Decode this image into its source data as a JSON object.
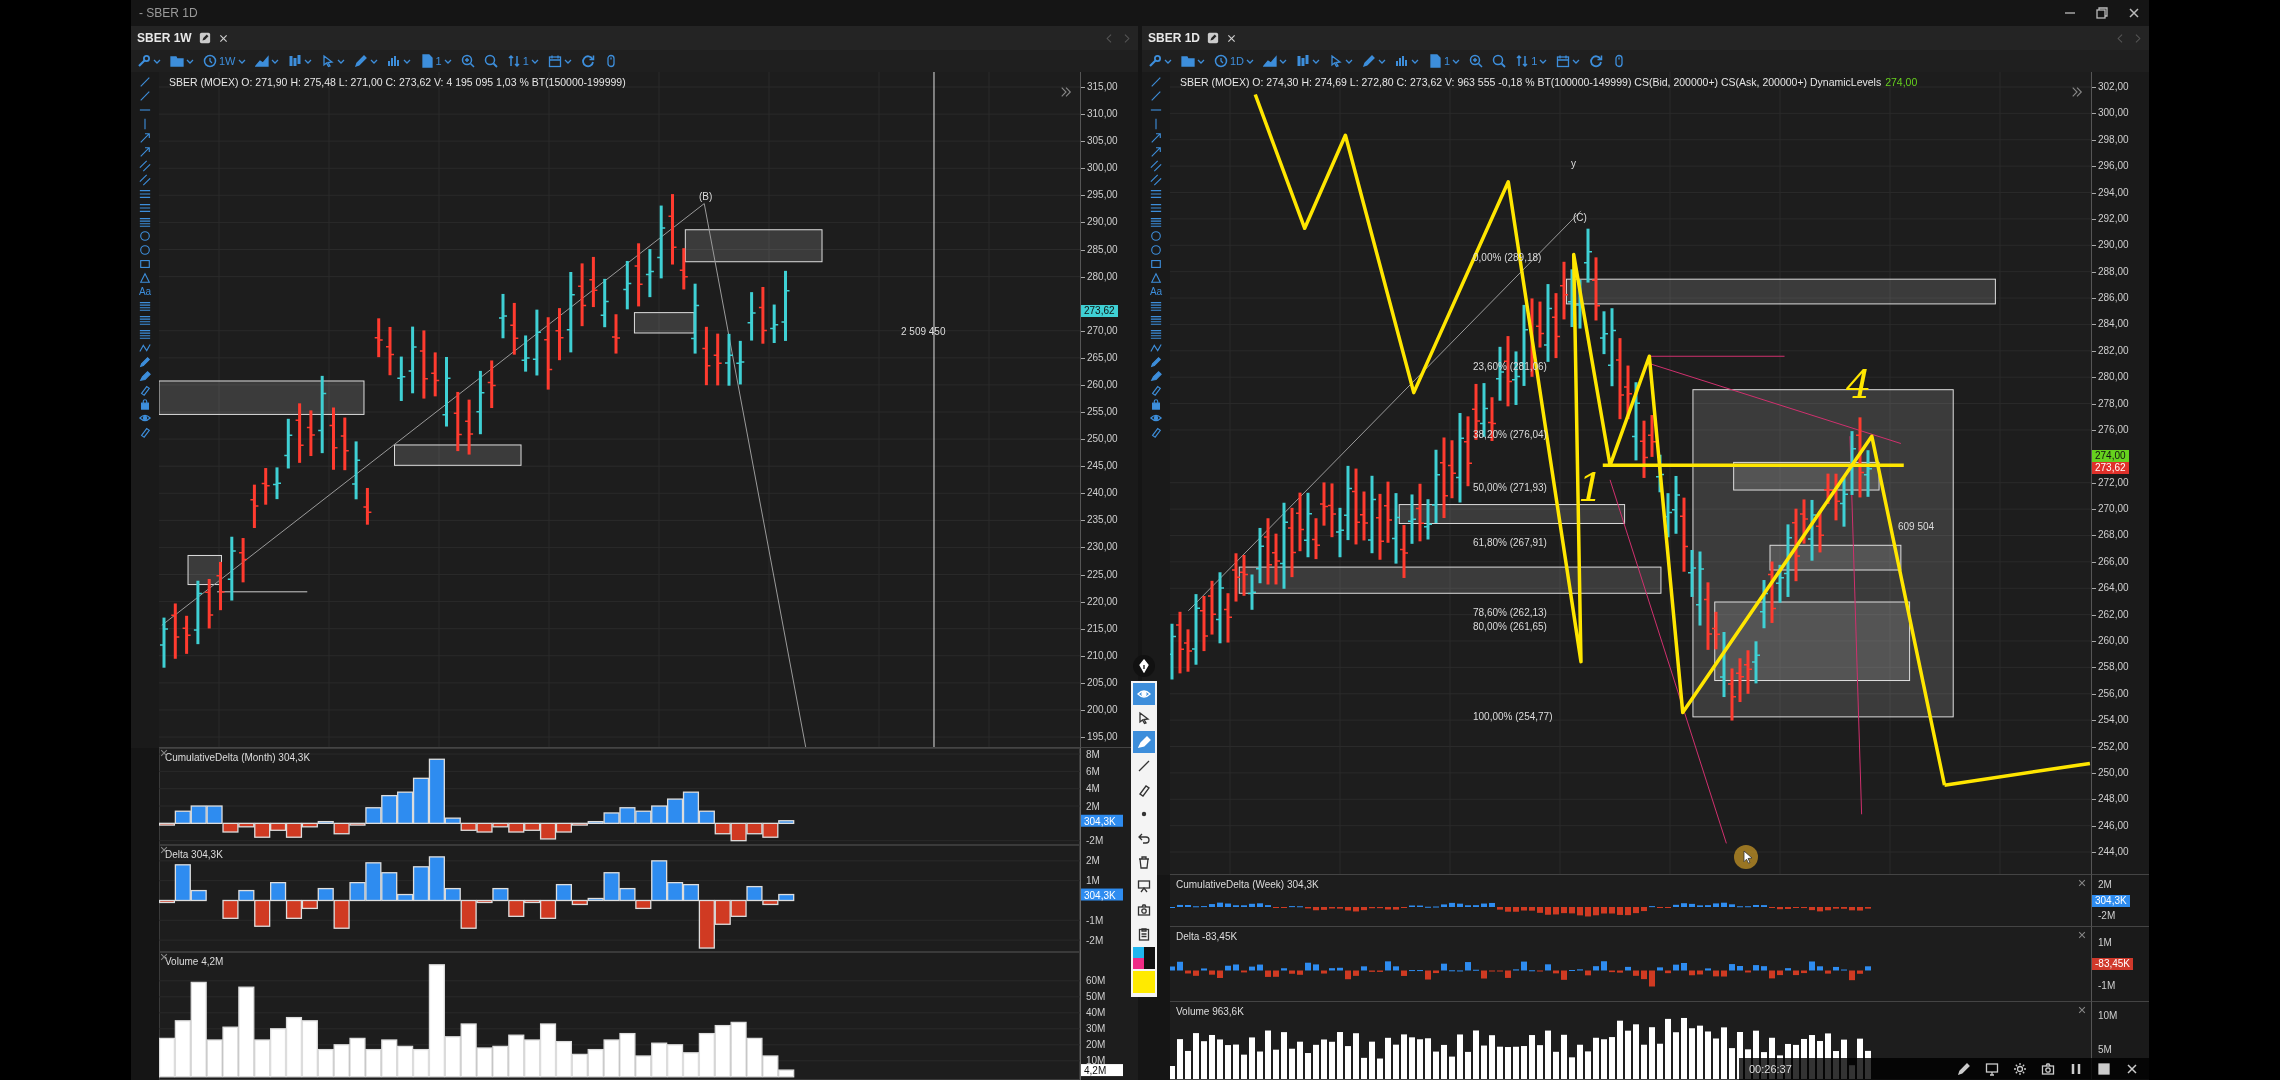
{
  "window": {
    "title": "- SBER 1D"
  },
  "panes": [
    {
      "tab": {
        "title": "SBER 1W"
      },
      "toolbar": {
        "timeframe": "1W",
        "template_count": "1",
        "sort_count": "1"
      },
      "tools": {
        "text_tool": "Aa"
      },
      "legend": "SBER (MOEX) O: 271,90  H: 275,48  L: 271,00  C: 273,62  V: 4 195 095  1,03 % BT(150000-199999)",
      "price_axis": {
        "ticks": [
          "315,00",
          "310,00",
          "305,00",
          "300,00",
          "295,00",
          "290,00",
          "285,00",
          "280,00",
          "270,00",
          "265,00",
          "260,00",
          "255,00",
          "250,00",
          "245,00",
          "240,00",
          "235,00",
          "230,00",
          "225,00",
          "220,00",
          "215,00",
          "210,00",
          "205,00",
          "200,00",
          "195,00"
        ],
        "markers": [
          {
            "text": "273,62",
            "color": "#3fd0d4"
          }
        ]
      },
      "chart_labels": [
        "(B)",
        "2 509 450"
      ],
      "indicators": [
        {
          "title": "CumulativeDelta (Month) 304,3K",
          "last": {
            "text": "304,3K",
            "color": "#2e8cf0"
          },
          "chart_data": {
            "type": "bar",
            "stacked": true,
            "grid": true,
            "categories": [
              null,
              null,
              null,
              null,
              null,
              null,
              null,
              null,
              null,
              null,
              null,
              null,
              null,
              null,
              null,
              null,
              null,
              null,
              null,
              null,
              null,
              null,
              null,
              null,
              null,
              null,
              null,
              null,
              null,
              null,
              null,
              null,
              null,
              null,
              null,
              null,
              null,
              null,
              null,
              null,
              null,
              null,
              null,
              null,
              null,
              null,
              null,
              null,
              null,
              null,
              null,
              null,
              null,
              null,
              null,
              null,
              null,
              null
            ],
            "ylim": [
              -2.5,
              8.7
            ],
            "yticks": [
              {
                "value": 8,
                "label": "8M"
              },
              {
                "value": 6,
                "label": "6M"
              },
              {
                "value": 4,
                "label": "4M"
              },
              {
                "value": 2,
                "label": "2M"
              },
              {
                "value": -2,
                "label": "-2M"
              }
            ],
            "series": [
              {
                "color": "#2e8cf0",
                "values": [
                  null,
                  1.4,
                  2.0,
                  2.0,
                  null,
                  null,
                  null,
                  null,
                  null,
                  null,
                  0.2,
                  null,
                  null,
                  1.8,
                  3.2,
                  3.6,
                  5.2,
                  7.4,
                  0.6,
                  null,
                  null,
                  null,
                  null,
                  null,
                  null,
                  null,
                  null,
                  0.2,
                  1.2,
                  1.8,
                  1.4,
                  2.0,
                  2.8,
                  3.6,
                  1.4,
                  null,
                  null,
                  null,
                  null,
                  0.3,
                  null,
                  null,
                  null,
                  null,
                  null,
                  null,
                  null,
                  null,
                  null,
                  null,
                  null,
                  null,
                  null,
                  null,
                  null,
                  null,
                  null,
                  null
                ]
              },
              {
                "color": "#d03a22",
                "values": [
                  -0.2,
                  null,
                  null,
                  null,
                  -1.0,
                  -0.4,
                  -1.6,
                  -0.8,
                  -1.6,
                  -0.4,
                  null,
                  -1.2,
                  -0.2,
                  null,
                  null,
                  null,
                  null,
                  null,
                  null,
                  -0.8,
                  -1.0,
                  -0.4,
                  -1.0,
                  -0.8,
                  -1.8,
                  -1.0,
                  -0.2,
                  null,
                  null,
                  null,
                  null,
                  null,
                  null,
                  null,
                  null,
                  -1.2,
                  -2.0,
                  -1.2,
                  -1.6,
                  null,
                  null,
                  null,
                  null,
                  null,
                  null,
                  null,
                  null,
                  null,
                  null,
                  null,
                  null,
                  null,
                  null,
                  null,
                  null,
                  null,
                  null,
                  null
                ]
              }
            ]
          }
        },
        {
          "title": "Delta 304,3K",
          "last": {
            "text": "304,3K",
            "color": "#2e8cf0"
          },
          "chart_data": {
            "type": "bar",
            "stacked": true,
            "grid": true,
            "categories": [
              null,
              null,
              null,
              null,
              null,
              null,
              null,
              null,
              null,
              null,
              null,
              null,
              null,
              null,
              null,
              null,
              null,
              null,
              null,
              null,
              null,
              null,
              null,
              null,
              null,
              null,
              null,
              null,
              null,
              null,
              null,
              null,
              null,
              null,
              null,
              null,
              null,
              null,
              null,
              null,
              null,
              null,
              null,
              null,
              null,
              null,
              null,
              null,
              null,
              null,
              null,
              null,
              null,
              null,
              null,
              null,
              null,
              null
            ],
            "ylim": [
              -2.6,
              2.8
            ],
            "yticks": [
              {
                "value": 2,
                "label": "2M"
              },
              {
                "value": 1,
                "label": "1M"
              },
              {
                "value": -1,
                "label": "-1M"
              },
              {
                "value": -2,
                "label": "-2M"
              }
            ],
            "series": [
              {
                "color": "#2e8cf0",
                "values": [
                  null,
                  1.8,
                  0.5,
                  null,
                  null,
                  0.5,
                  null,
                  0.9,
                  null,
                  null,
                  0.6,
                  null,
                  0.9,
                  1.9,
                  1.4,
                  0.3,
                  1.7,
                  2.2,
                  0.6,
                  null,
                  null,
                  0.6,
                  null,
                  null,
                  null,
                  0.8,
                  null,
                  0.1,
                  1.4,
                  0.6,
                  null,
                  2.0,
                  0.9,
                  0.8,
                  null,
                  null,
                  null,
                  0.7,
                  null,
                  0.3,
                  null,
                  null,
                  null,
                  null,
                  null,
                  null,
                  null,
                  null,
                  null,
                  null,
                  null,
                  null,
                  null,
                  null,
                  null,
                  null,
                  null,
                  null
                ]
              },
              {
                "color": "#d03a22",
                "values": [
                  -0.1,
                  null,
                  null,
                  null,
                  -0.9,
                  null,
                  -1.3,
                  null,
                  -0.9,
                  -0.4,
                  null,
                  -1.4,
                  null,
                  null,
                  null,
                  null,
                  null,
                  null,
                  null,
                  -1.4,
                  -0.1,
                  null,
                  -0.8,
                  -0.1,
                  -0.9,
                  null,
                  -0.2,
                  null,
                  null,
                  null,
                  -0.4,
                  null,
                  null,
                  null,
                  -2.4,
                  -1.2,
                  -0.8,
                  null,
                  -0.2,
                  null,
                  null,
                  null,
                  null,
                  null,
                  null,
                  null,
                  null,
                  null,
                  null,
                  null,
                  null,
                  null,
                  null,
                  null,
                  null,
                  null,
                  null,
                  null
                ]
              }
            ]
          }
        },
        {
          "title": "Volume 4,2M",
          "last": {
            "text": "4,2M",
            "color": "#ffffff"
          },
          "chart_data": {
            "type": "bar",
            "grid": true,
            "categories": [
              null,
              null,
              null,
              null,
              null,
              null,
              null,
              null,
              null,
              null,
              null,
              null,
              null,
              null,
              null,
              null,
              null,
              null,
              null,
              null,
              null,
              null,
              null,
              null,
              null,
              null,
              null,
              null,
              null,
              null,
              null,
              null,
              null,
              null,
              null,
              null,
              null,
              null,
              null,
              null,
              null,
              null,
              null,
              null,
              null,
              null,
              null,
              null,
              null,
              null,
              null,
              null,
              null,
              null,
              null,
              null,
              null,
              null
            ],
            "ylim": [
              -2,
              78
            ],
            "yticks": [
              {
                "value": 60,
                "label": "60M"
              },
              {
                "value": 50,
                "label": "50M"
              },
              {
                "value": 40,
                "label": "40M"
              },
              {
                "value": 30,
                "label": "30M"
              },
              {
                "value": 20,
                "label": "20M"
              },
              {
                "value": 10,
                "label": "10M"
              }
            ],
            "series": [
              {
                "color": "#ffffff",
                "values": [
                  24,
                  35,
                  59,
                  23,
                  31,
                  56,
                  23,
                  30,
                  37,
                  35,
                  17,
                  20,
                  24,
                  17,
                  23,
                  19,
                  17,
                  70,
                  25,
                  33,
                  18,
                  19,
                  26,
                  23,
                  33,
                  22,
                  14,
                  17,
                  23,
                  27,
                  13,
                  21,
                  20,
                  15,
                  27,
                  32,
                  34,
                  24,
                  13,
                  4.2,
                  null,
                  null,
                  null,
                  null,
                  null,
                  null,
                  null,
                  null,
                  null,
                  null,
                  null,
                  null,
                  null,
                  null,
                  null,
                  null,
                  null,
                  null
                ]
              }
            ]
          }
        }
      ]
    },
    {
      "tab": {
        "title": "SBER 1D"
      },
      "toolbar": {
        "timeframe": "1D",
        "template_count": "1",
        "sort_count": "1"
      },
      "tools": {
        "text_tool": "Aa"
      },
      "legend": "SBER (MOEX) O: 274,30  H: 274,69  L: 272,80  C: 273,62  V: 963 555  -0,18 % BT(100000-149999) CS(Bid, 200000+) CS(Ask, 200000+) DynamicLevels",
      "legend_value": "274,00",
      "price_axis": {
        "ticks": [
          "302,00",
          "300,00",
          "298,00",
          "296,00",
          "294,00",
          "292,00",
          "290,00",
          "288,00",
          "286,00",
          "284,00",
          "282,00",
          "280,00",
          "278,00",
          "276,00",
          "272,00",
          "270,00",
          "268,00",
          "266,00",
          "264,00",
          "262,00",
          "260,00",
          "258,00",
          "256,00",
          "254,00",
          "252,00",
          "250,00",
          "248,00",
          "246,00",
          "244,00"
        ],
        "markers": [
          {
            "text": "274,00",
            "color": "#66d11e"
          },
          {
            "text": "273,62",
            "color": "#e0312b"
          }
        ]
      },
      "chart_labels": [
        "y",
        "(C)",
        "0,00% (289,18)",
        "23,60% (281,06)",
        "38,20% (276,04)",
        "50,00% (271,93)",
        "61,80% (267,91)",
        "78,60% (262,13)",
        "80,00% (261,65)",
        "100,00% (254,77)",
        "609 504"
      ],
      "handwritten": [
        "1",
        "4"
      ],
      "indicators": [
        {
          "title": "CumulativeDelta (Week) 304,3K",
          "axis": [
            {
              "text": "2M"
            },
            {
              "text": "304,3K",
              "color": "#2e8cf0"
            },
            {
              "text": "-2M"
            }
          ]
        },
        {
          "title": "Delta -83,45K",
          "axis": [
            {
              "text": "1M"
            },
            {
              "text": "-83,45K",
              "color": "#d0392b"
            },
            {
              "text": "-1M"
            }
          ]
        },
        {
          "title": "Volume 963,6K",
          "axis": [
            {
              "text": "10M"
            },
            {
              "text": "5M"
            }
          ]
        }
      ]
    }
  ],
  "annotation_toolbar": {
    "tools": [
      {
        "kind": "eye",
        "selected": true
      },
      {
        "kind": "cursor",
        "selected": false
      },
      {
        "kind": "highlighter",
        "selected": true
      },
      {
        "kind": "line",
        "selected": false
      },
      {
        "kind": "eraser",
        "selected": false
      },
      {
        "kind": "dot",
        "selected": false
      },
      {
        "kind": "undo",
        "selected": false
      },
      {
        "kind": "trash",
        "selected": false
      },
      {
        "kind": "board",
        "selected": false
      },
      {
        "kind": "camera",
        "selected": false
      },
      {
        "kind": "clipboard",
        "selected": false
      }
    ],
    "palette": [
      {
        "color": "#1fb6ef"
      },
      {
        "color": "#111111"
      },
      {
        "color": "#ef2b86"
      },
      {
        "color": "#111111"
      }
    ],
    "current": {
      "color": "#ffea00"
    }
  },
  "player": {
    "time": "00:26:37"
  }
}
